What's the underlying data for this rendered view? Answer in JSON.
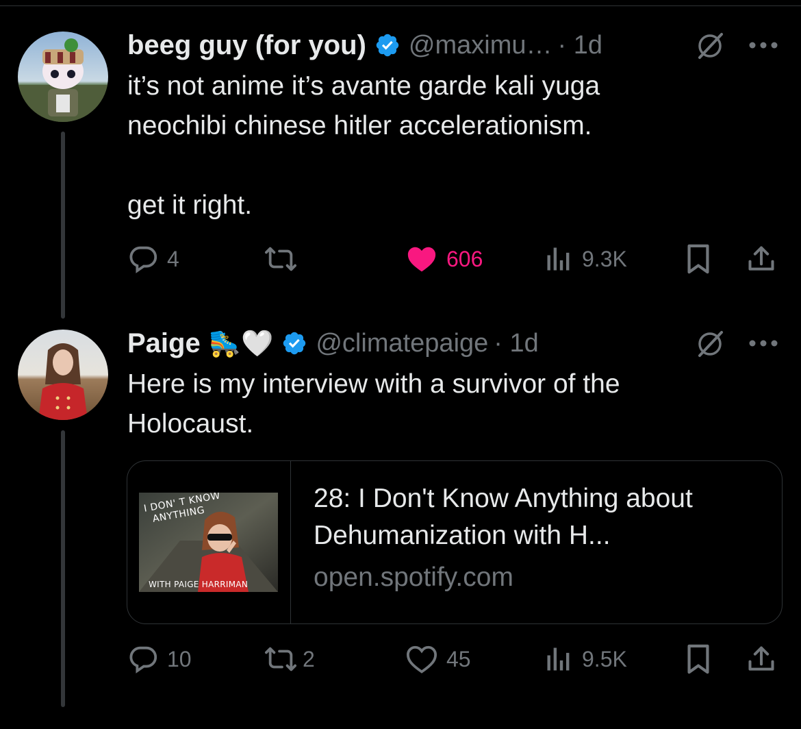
{
  "tweets": [
    {
      "display_name": "beeg guy (for you)",
      "handle": "@maximu…",
      "time": "· 1d",
      "text": "it’s not anime it’s avante garde kali yuga\nneochibi chinese hitler accelerationism.\n\nget it right.",
      "actions": {
        "replies": "4",
        "reposts": "",
        "likes": "606",
        "views": "9.3K"
      },
      "liked": true
    },
    {
      "display_name": "Paige",
      "name_emoji": "🛼🤍",
      "handle": "@climatepaige",
      "time": "· 1d",
      "text": "Here is my interview with a survivor of the\nHolocaust.",
      "card": {
        "thumbnail_title": "I DON' T KNOW\n  ANYTHING",
        "thumbnail_caption": "WITH PAIGE HARRIMAN",
        "title": "28: I Don't Know Anything about Dehumanization with H...",
        "domain": "open.spotify.com"
      },
      "actions": {
        "replies": "10",
        "reposts": "2",
        "likes": "45",
        "views": "9.5K"
      },
      "liked": false
    }
  ],
  "colors": {
    "background": "#000000",
    "text": "#e7e9ea",
    "secondary": "#71767b",
    "verified": "#1d9bf0",
    "like": "#f91880",
    "divider": "#2f3336"
  },
  "icons": [
    "verified-badge-icon",
    "grok-icon",
    "more-icon",
    "reply-icon",
    "repost-icon",
    "like-icon",
    "views-icon",
    "bookmark-icon",
    "share-icon"
  ]
}
